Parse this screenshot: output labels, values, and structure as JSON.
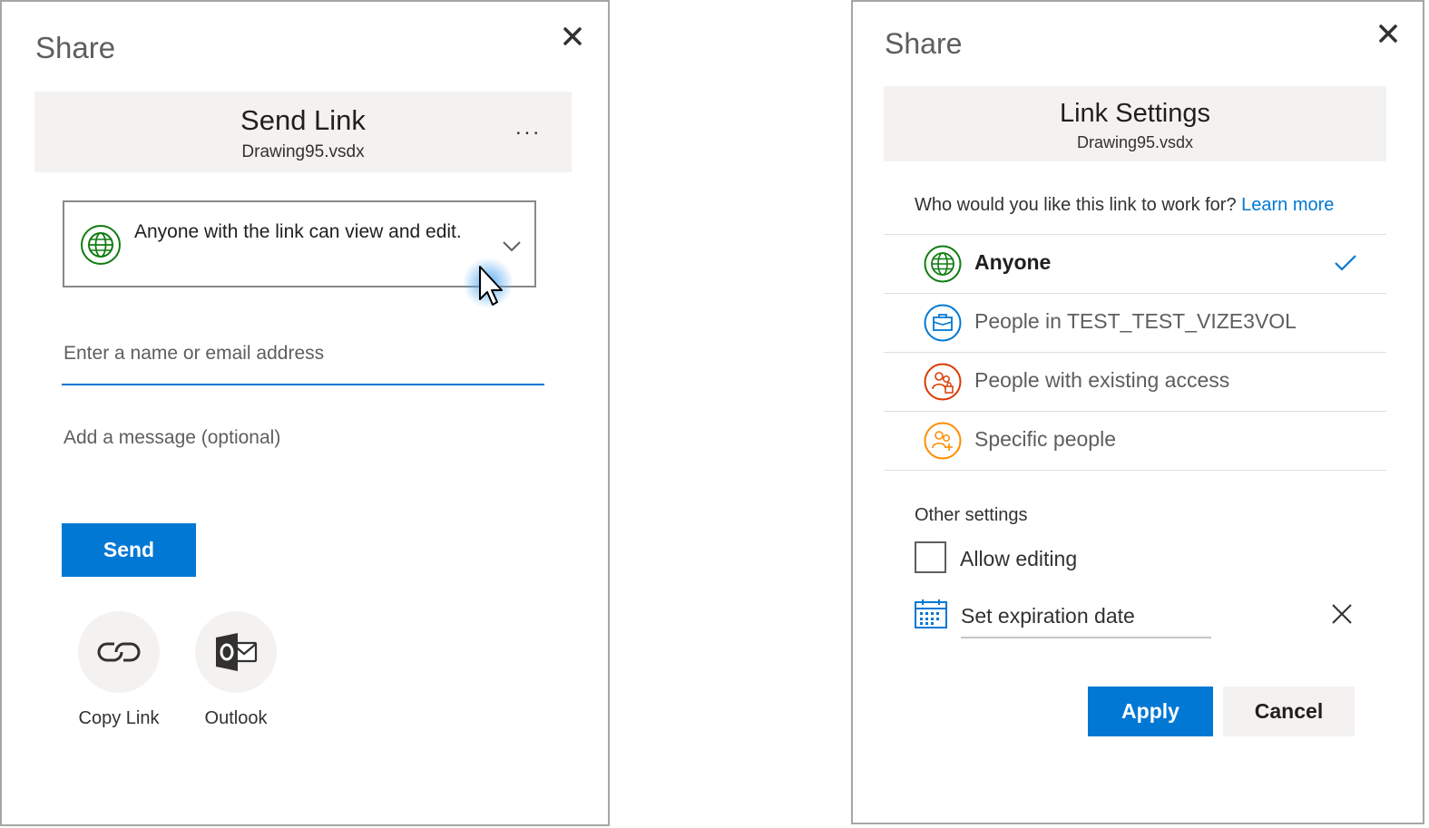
{
  "send_link_dialog": {
    "title": "Share",
    "header_title": "Send Link",
    "file_name": "Drawing95.vsdx",
    "more_label": "...",
    "permission_text": "Anyone with the link can view and edit.",
    "recipient_placeholder": "Enter a name or email address",
    "message_placeholder": "Add a message (optional)",
    "send_label": "Send",
    "share_options": [
      {
        "label": "Copy Link",
        "icon": "link-icon"
      },
      {
        "label": "Outlook",
        "icon": "outlook-icon"
      }
    ]
  },
  "link_settings_dialog": {
    "title": "Share",
    "header_title": "Link Settings",
    "file_name": "Drawing95.vsdx",
    "question": "Who would you like this link to work for?",
    "learn_more": "Learn more",
    "options": [
      {
        "label": "Anyone",
        "icon": "globe-icon",
        "selected": true,
        "color": "#107c10"
      },
      {
        "label": "People in TEST_TEST_VIZE3VOL",
        "icon": "briefcase-icon",
        "selected": false,
        "color": "#0078d4"
      },
      {
        "label": "People with existing access",
        "icon": "people-lock-icon",
        "selected": false,
        "color": "#d83b01"
      },
      {
        "label": "Specific people",
        "icon": "people-add-icon",
        "selected": false,
        "color": "#ff8c00"
      }
    ],
    "other_settings_label": "Other settings",
    "allow_editing_label": "Allow editing",
    "allow_editing_checked": false,
    "expiration_placeholder": "Set expiration date",
    "apply_label": "Apply",
    "cancel_label": "Cancel"
  },
  "colors": {
    "accent": "#0078d4",
    "header_bg": "#f3f2f1",
    "globe_green": "#107c10",
    "border": "#8a8886"
  }
}
